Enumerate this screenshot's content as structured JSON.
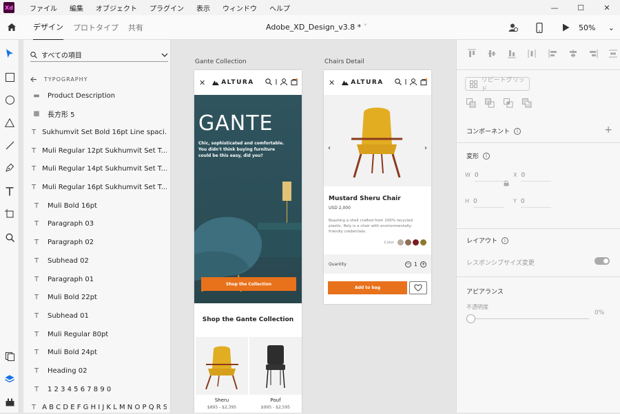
{
  "app": {
    "logo_text": "Xd"
  },
  "menu": [
    "ファイル",
    "編集",
    "オブジェクト",
    "プラグイン",
    "表示",
    "ウィンドウ",
    "ヘルプ"
  ],
  "window_controls": [
    "—",
    "☐",
    "✕"
  ],
  "toolbar": {
    "tabs": [
      "デザイン",
      "プロトタイプ",
      "共有"
    ],
    "document_title": "Adobe_XD_Design_v3.8 *",
    "zoom": "50%"
  },
  "layers": {
    "search_label": "すべての項目",
    "section": "TYPOGRAPHY",
    "items": [
      {
        "icon": "folder",
        "label": "Product Description"
      },
      {
        "icon": "rect",
        "label": "長方形 5"
      },
      {
        "icon": "text",
        "label": "Sukhumvit Set Bold 16pt Line spaci..."
      },
      {
        "icon": "text",
        "label": "Muli Regular 12pt Sukhumvit Set T..."
      },
      {
        "icon": "text",
        "label": "Muli Regular 14pt Sukhumvit Set T..."
      },
      {
        "icon": "text",
        "label": "Muli Regular 16pt Sukhumvit Set T..."
      },
      {
        "icon": "text",
        "label": "Muli Bold 16pt"
      },
      {
        "icon": "text",
        "label": "Paragraph 03"
      },
      {
        "icon": "text",
        "label": "Paragraph 02"
      },
      {
        "icon": "text",
        "label": "Subhead 02"
      },
      {
        "icon": "text",
        "label": "Paragraph 01"
      },
      {
        "icon": "text",
        "label": "Muli Bold 22pt"
      },
      {
        "icon": "text",
        "label": "Subhead 01"
      },
      {
        "icon": "text",
        "label": "Muli Regular 80pt"
      },
      {
        "icon": "text",
        "label": "Muli Bold 24pt"
      },
      {
        "icon": "text",
        "label": "Heading 02"
      },
      {
        "icon": "text",
        "label": "1 2 3 4 5 6 7 8 9 0"
      },
      {
        "icon": "text",
        "label": "A B C D E F G H I J K L M N O P Q R S..."
      }
    ]
  },
  "artboards": {
    "collection": {
      "label": "Gante Collection",
      "brand": "ALTURA",
      "hero_title": "GANTE",
      "hero_copy": "Chic, sophisticated and comfortable. You didn't think buying furniture could be this easy, did you?",
      "cta": "Shop the Collection",
      "shop_title": "Shop the Gante Collection",
      "products": [
        {
          "name": "Sheru",
          "price": "$895 - $2,395"
        },
        {
          "name": "Pouf",
          "price": "$995 - $2,595"
        }
      ]
    },
    "detail": {
      "label": "Chairs Detail",
      "brand": "ALTURA",
      "product_name": "Mustard Sheru Chair",
      "price": "USD 2,000",
      "description": "Boasting a shell crafted from 100% recycled plastic, Rely is a chair with environmentally-friendly credentials.",
      "color_label": "Color",
      "swatches": [
        "#b9aca0",
        "#8c6f55",
        "#7a1b25",
        "#8a7a2e"
      ],
      "quantity_label": "Quantity",
      "quantity": "1",
      "add_to_bag": "Add to bag"
    }
  },
  "props": {
    "repeat_grid": "リピートグリッド",
    "component": "コンポーネント",
    "transform": "変形",
    "w_label": "W",
    "w_value": "0",
    "x_label": "X",
    "x_value": "0",
    "h_label": "H",
    "h_value": "0",
    "y_label": "Y",
    "y_value": "0",
    "layout": "レイアウト",
    "responsive": "レスポンシブサイズ変更",
    "appearance": "アピアランス",
    "opacity_label": "不透明度",
    "opacity_value": "0%"
  },
  "colors": {
    "accent": "#e8711b",
    "selected_tool": "#1473e6",
    "hero": "#2f525b"
  }
}
